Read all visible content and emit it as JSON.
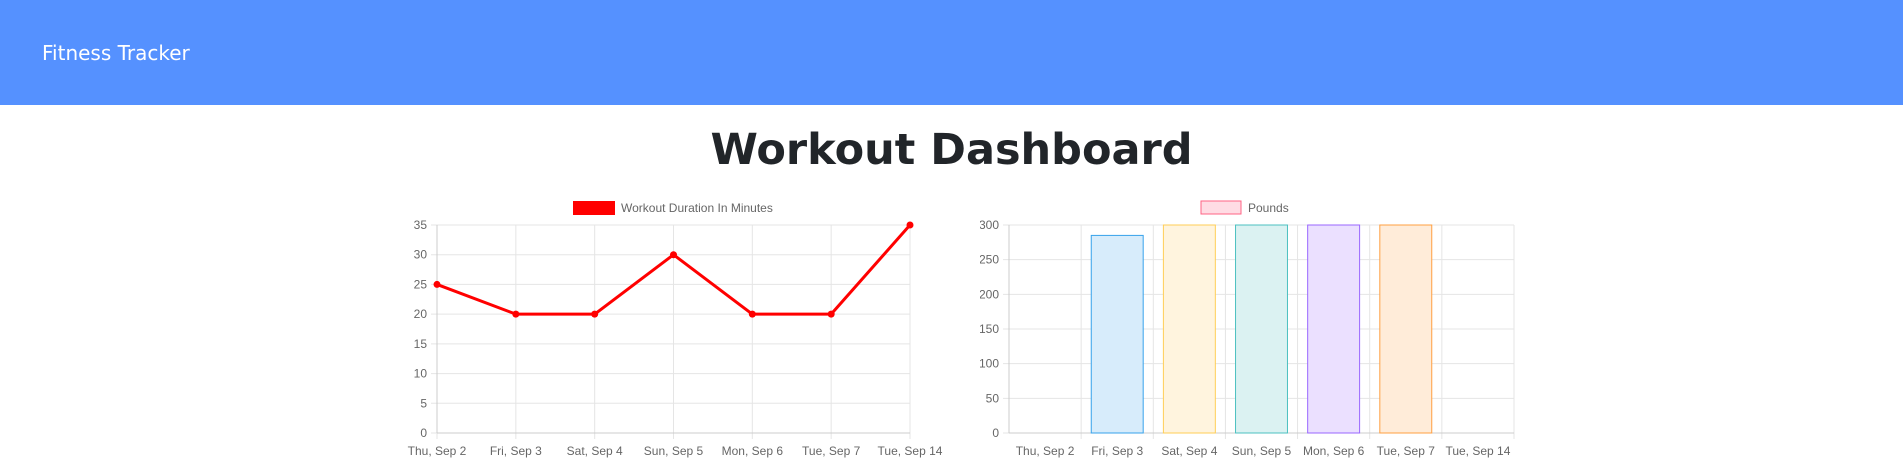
{
  "navbar": {
    "brand": "Fitness Tracker",
    "color": "#5591ff"
  },
  "main": {
    "title": "Workout Dashboard"
  },
  "chart_data": [
    {
      "type": "line",
      "legend": "Workout Duration In Minutes",
      "legend_position": "top",
      "color": "#ff0000",
      "categories": [
        "Thu, Sep 2",
        "Fri, Sep 3",
        "Sat, Sep 4",
        "Sun, Sep 5",
        "Mon, Sep 6",
        "Tue, Sep 7",
        "Tue, Sep 14"
      ],
      "values": [
        25,
        20,
        20,
        30,
        20,
        20,
        35
      ],
      "ylim": [
        0,
        35
      ],
      "yticks": [
        0,
        5,
        10,
        15,
        20,
        25,
        30,
        35
      ],
      "grid": true
    },
    {
      "type": "bar",
      "legend": "Pounds",
      "legend_position": "top",
      "legend_fill": "#ffdce4",
      "legend_stroke": "#ff6384",
      "categories": [
        "Thu, Sep 2",
        "Fri, Sep 3",
        "Sat, Sep 4",
        "Sun, Sep 5",
        "Mon, Sep 6",
        "Tue, Sep 7",
        "Tue, Sep 14"
      ],
      "values": [
        0,
        285,
        300,
        300,
        300,
        300,
        0
      ],
      "ylim": [
        0,
        300
      ],
      "yticks": [
        0,
        50,
        100,
        150,
        200,
        250,
        300
      ],
      "grid": true,
      "bar_fills": [
        "#ffdce4",
        "#d7ecfb",
        "#fff4de",
        "#dbf2f2",
        "#ebe0ff",
        "#ffecd9",
        "#f4f5f5"
      ],
      "bar_strokes": [
        "#ff6384",
        "#36a2eb",
        "#ffce56",
        "#4bc0c0",
        "#9966ff",
        "#ff9f40",
        "#c9cbcf"
      ]
    }
  ]
}
